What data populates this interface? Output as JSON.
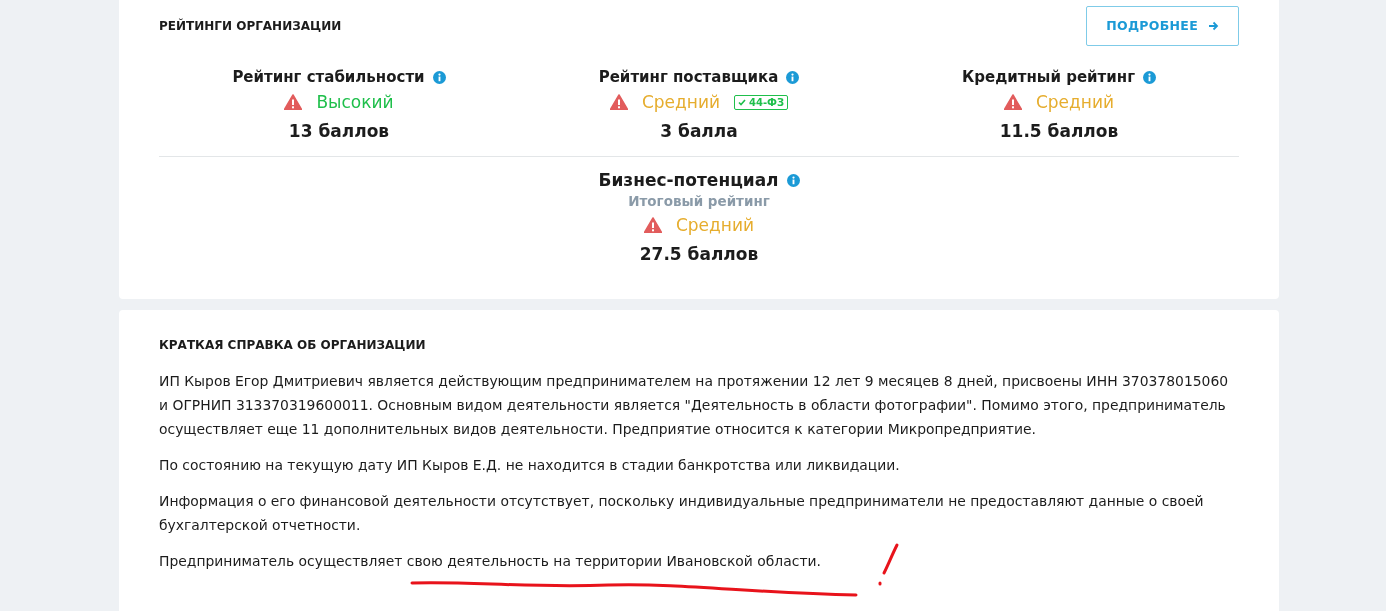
{
  "ratings_card": {
    "title": "РЕЙТИНГИ ОРГАНИЗАЦИИ",
    "details_button": "ПОДРОБНЕЕ",
    "ratings": [
      {
        "name": "Рейтинг стабильности",
        "status": "Высокий",
        "color": "#1fbf4b",
        "points": "13 баллов"
      },
      {
        "name": "Рейтинг поставщика",
        "status": "Средний",
        "color": "#e6ad2e",
        "badge": "44-ФЗ",
        "points": "3 балла"
      },
      {
        "name": "Кредитный рейтинг",
        "status": "Средний",
        "color": "#e6ad2e",
        "points": "11.5 баллов"
      }
    ],
    "summary": {
      "name": "Бизнес-потенциал",
      "subtitle": "Итоговый рейтинг",
      "status": "Средний",
      "color": "#e6ad2e",
      "points": "27.5 баллов"
    }
  },
  "brief_card": {
    "title": "КРАТКАЯ СПРАВКА ОБ ОРГАНИЗАЦИИ",
    "paragraphs": [
      "ИП Кыров Егор Дмитриевич является действующим предпринимателем на протяжении 12 лет 9 месяцев 8 дней, присвоены ИНН 370378015060 и ОГРНИП 313370319600011. Основным видом деятельности является \"Деятельность в области фотографии\". Помимо этого, предприниматель осуществляет еще 11 дополнительных видов деятельности. Предприятие относится к категории Микропредприятие.",
      "По состоянию на текущую дату ИП Кыров Е.Д. не находится в стадии банкротства или ликвидации.",
      "Информация о его финансовой деятельности отсутствует, поскольку индивидуальные предприниматели не предоставляют данные о своей бухгалтерской отчетности.",
      "Предприниматель осуществляет свою деятельность на территории Ивановской области."
    ]
  }
}
